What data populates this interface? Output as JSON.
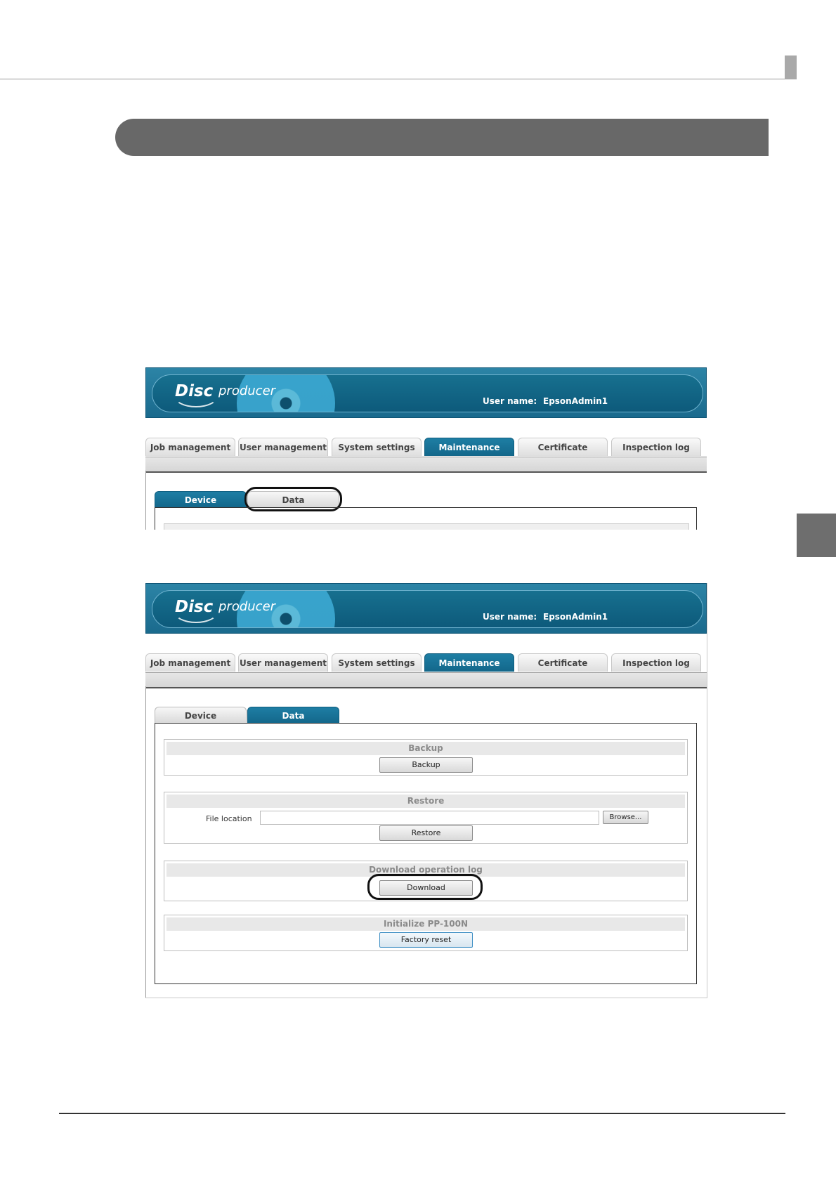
{
  "app": {
    "logo_disc": "Disc",
    "logo_producer": "producer"
  },
  "user": {
    "label": "User name:",
    "value": "EpsonAdmin1"
  },
  "nav_tabs": [
    {
      "label": "Job management"
    },
    {
      "label": "User management"
    },
    {
      "label": "System settings"
    },
    {
      "label": "Maintenance"
    },
    {
      "label": "Certificate"
    },
    {
      "label": "Inspection log"
    }
  ],
  "active_nav": "Maintenance",
  "sub_tabs": [
    {
      "label": "Device"
    },
    {
      "label": "Data"
    }
  ],
  "screenshot1_active_sub_tab": "Device",
  "screenshot2_active_sub_tab": "Data",
  "sections": {
    "backup": {
      "title": "Backup",
      "button": "Backup"
    },
    "restore": {
      "title": "Restore",
      "file_label": "File location",
      "file_value": "",
      "browse": "Browse...",
      "button": "Restore"
    },
    "download_log": {
      "title": "Download operation log",
      "button": "Download"
    },
    "initialize": {
      "title": "Initialize PP-100N",
      "button": "Factory reset"
    }
  },
  "colors": {
    "brand": "#1a6a8d",
    "section_bar": "#686868",
    "callout": "#111111"
  }
}
